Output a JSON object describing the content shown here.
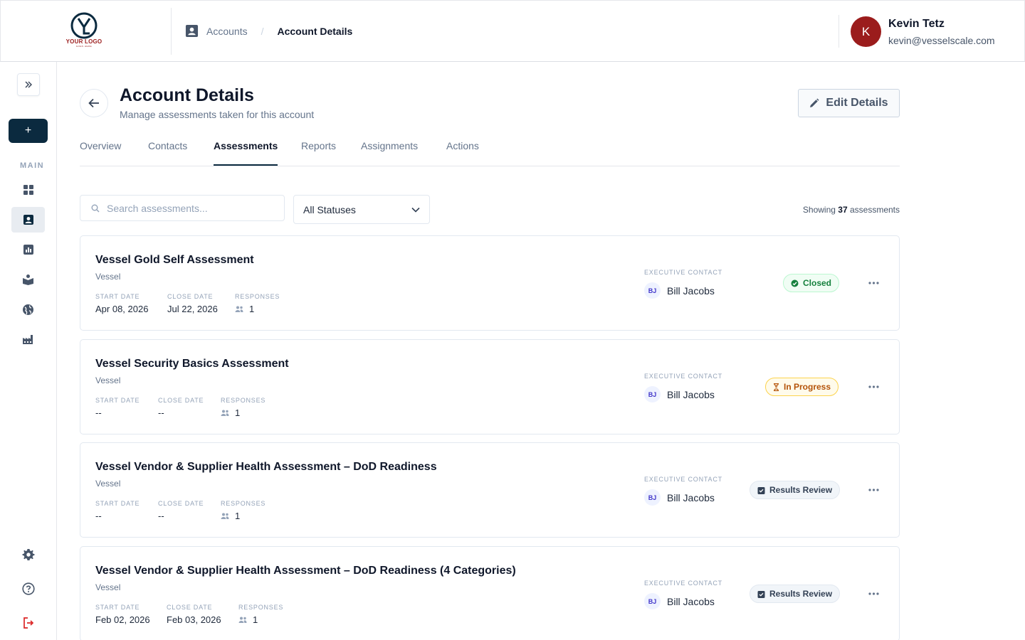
{
  "header": {
    "logo_text": "YOUR LOGO",
    "logo_sub": "GOES HERE",
    "breadcrumb": {
      "parent": "Accounts",
      "separator": "/",
      "current": "Account Details"
    },
    "user": {
      "initial": "K",
      "name": "Kevin Tetz",
      "email": "kevin@vesselscale.com"
    }
  },
  "sidebar": {
    "add_label": "+",
    "section_label": "MAIN",
    "items": [
      {
        "icon": "dashboard-icon"
      },
      {
        "icon": "accounts-icon",
        "active": true
      },
      {
        "icon": "reports-icon"
      },
      {
        "icon": "learning-icon"
      },
      {
        "icon": "globe-icon"
      },
      {
        "icon": "factory-icon"
      }
    ],
    "bottom": [
      {
        "icon": "settings-icon"
      },
      {
        "icon": "help-icon"
      },
      {
        "icon": "logout-icon"
      }
    ]
  },
  "page": {
    "title": "Account Details",
    "subtitle": "Manage assessments taken for this account",
    "edit_label": "Edit Details"
  },
  "tabs": [
    {
      "label": "Overview"
    },
    {
      "label": "Contacts"
    },
    {
      "label": "Assessments",
      "active": true
    },
    {
      "label": "Reports"
    },
    {
      "label": "Assignments"
    },
    {
      "label": "Actions"
    }
  ],
  "filters": {
    "search_placeholder": "Search assessments...",
    "status_selected": "All Statuses",
    "showing_prefix": "Showing",
    "showing_count": "37",
    "showing_suffix": "assessments"
  },
  "labels": {
    "start_date": "START DATE",
    "close_date": "CLOSE DATE",
    "responses": "RESPONSES",
    "executive_contact": "EXECUTIVE CONTACT"
  },
  "assessments": [
    {
      "title": "Vessel Gold Self Assessment",
      "org": "Vessel",
      "start": "Apr 08, 2026",
      "close": "Jul 22, 2026",
      "responses": "1",
      "contact_initials": "BJ",
      "contact": "Bill Jacobs",
      "status": "Closed",
      "status_type": "closed"
    },
    {
      "title": "Vessel Security Basics Assessment",
      "org": "Vessel",
      "start": "--",
      "close": "--",
      "responses": "1",
      "contact_initials": "BJ",
      "contact": "Bill Jacobs",
      "status": "In Progress",
      "status_type": "progress"
    },
    {
      "title": "Vessel Vendor & Supplier Health Assessment – DoD Readiness",
      "org": "Vessel",
      "start": "--",
      "close": "--",
      "responses": "1",
      "contact_initials": "BJ",
      "contact": "Bill Jacobs",
      "status": "Results Review",
      "status_type": "review"
    },
    {
      "title": "Vessel Vendor & Supplier Health Assessment – DoD Readiness (4 Categories)",
      "org": "Vessel",
      "start": "Feb 02, 2026",
      "close": "Feb 03, 2026",
      "responses": "1",
      "contact_initials": "BJ",
      "contact": "Bill Jacobs",
      "status": "Results Review",
      "status_type": "review"
    }
  ],
  "colors": {
    "brand_dark": "#0b2a3f",
    "logo_red": "#9b1c1c",
    "closed": "#15803d",
    "progress": "#b45309"
  }
}
